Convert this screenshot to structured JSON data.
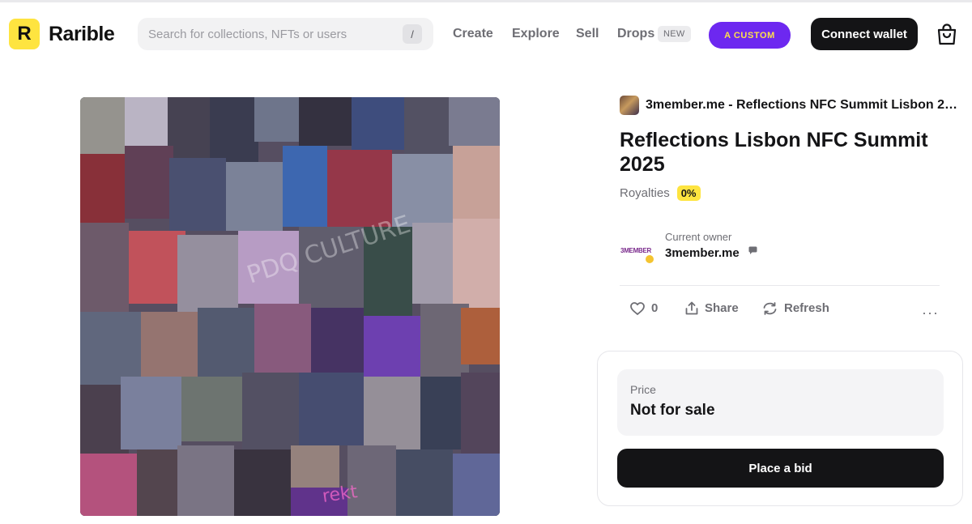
{
  "header": {
    "logo_mark": "R",
    "logo_text": "Rarible",
    "search": {
      "placeholder": "Search for collections, NFTs or users",
      "shortcut": "/"
    },
    "nav": [
      "Create",
      "Explore",
      "Sell",
      "Drops"
    ],
    "drops_badge": "NEW",
    "custom_button": "A CUSTOM",
    "connect_button": "Connect wallet",
    "cart_icon": "shopping-bag-icon"
  },
  "item": {
    "collection_name": "3member.me - Reflections NFC Summit Lisbon 2025",
    "title": "Reflections Lisbon NFC Summit 2025",
    "royalties_label": "Royalties",
    "royalties_value": "0%",
    "owner_label": "Current owner",
    "owner_name": "3member.me",
    "owner_avatar_text": "3MEMBER",
    "likes": "0",
    "share_label": "Share",
    "refresh_label": "Refresh",
    "more_label": "···"
  },
  "price": {
    "label": "Price",
    "value": "Not for sale",
    "bid_button": "Place a bid"
  },
  "colors": {
    "brand_yellow": "#fee440",
    "accent_purple": "#6d28f0",
    "dark": "#141416"
  }
}
